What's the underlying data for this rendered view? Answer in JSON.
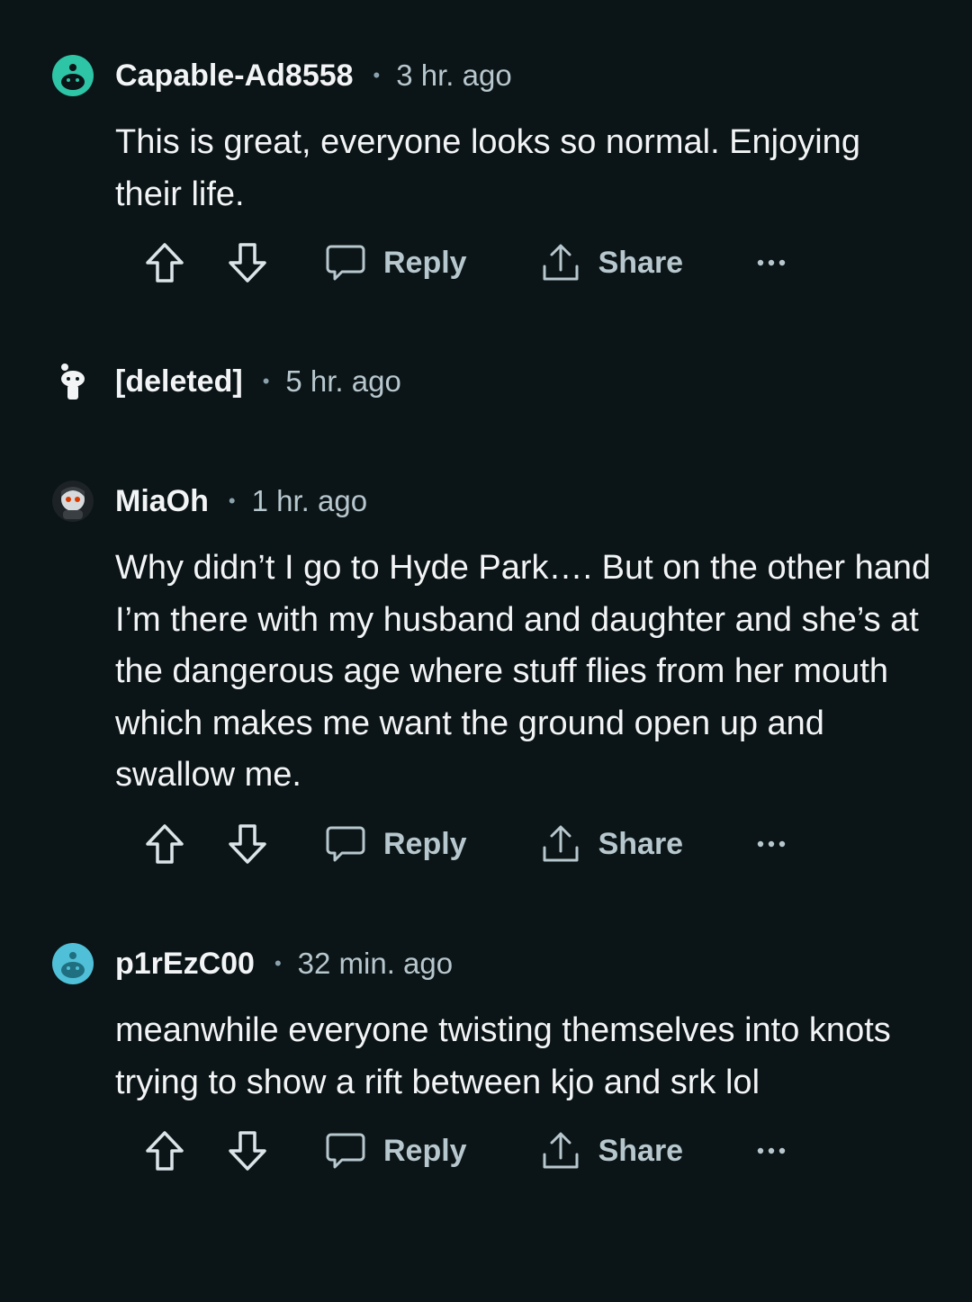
{
  "comments": [
    {
      "username": "Capable-Ad8558",
      "separator": "•",
      "time": "3 hr. ago",
      "text": "This is great, everyone looks so normal. Enjoying their life.",
      "avatar_color": "#2ec4a6",
      "actions": {
        "reply": "Reply",
        "share": "Share"
      }
    },
    {
      "username": "[deleted]",
      "separator": "•",
      "time": "5 hr. ago",
      "avatar_color": "#0b1416"
    },
    {
      "username": "MiaOh",
      "separator": "•",
      "time": "1 hr. ago",
      "text": "Why didn’t I go to Hyde Park…. But on the other hand I’m there with my husband and daughter and she’s at the dangerous age where stuff flies from her mouth which makes me want the ground open up and swallow me.",
      "avatar_color": "#2a2f33",
      "actions": {
        "reply": "Reply",
        "share": "Share"
      }
    },
    {
      "username": "p1rEzC00",
      "separator": "•",
      "time": "32 min. ago",
      "text": "meanwhile everyone twisting themselves into knots trying to show a rift between kjo and srk lol",
      "avatar_color": "#4fc0d8",
      "actions": {
        "reply": "Reply",
        "share": "Share"
      }
    }
  ]
}
